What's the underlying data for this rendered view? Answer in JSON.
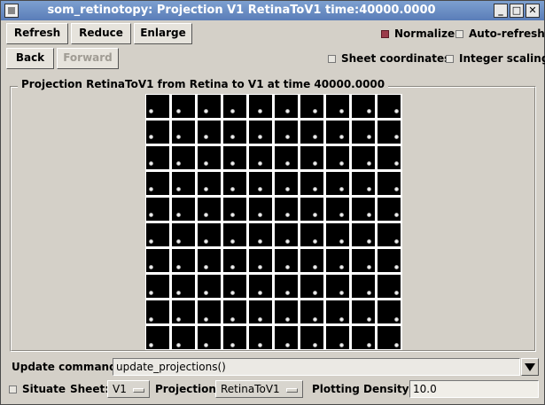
{
  "window": {
    "title": "som_retinotopy: Projection V1 RetinaToV1 time:40000.0000",
    "minimize_icon": "minimize-icon",
    "maximize_icon": "maximize-icon",
    "close_icon": "close-icon"
  },
  "toolbar": {
    "refresh_label": "Refresh",
    "reduce_label": "Reduce",
    "enlarge_label": "Enlarge",
    "back_label": "Back",
    "forward_label": "Forward"
  },
  "options": {
    "normalize_label": "Normalize",
    "normalize_checked": true,
    "auto_refresh_label": "Auto-refresh",
    "auto_refresh_checked": false,
    "sheet_coordinates_label": "Sheet coordinates",
    "sheet_coordinates_checked": false,
    "integer_scaling_label": "Integer scaling",
    "integer_scaling_checked": false
  },
  "projection": {
    "frame_label": "Projection RetinaToV1 from Retina to V1 at time 40000.0000",
    "grid_rows": 10,
    "grid_cols": 10
  },
  "bottom": {
    "update_command_label": "Update command:",
    "update_command_value": "update_projections()",
    "situate_label": "Situate",
    "situate_checked": false,
    "sheet_label": "Sheet:",
    "sheet_value": "V1",
    "projection_label": "Projection:",
    "projection_value": "RetinaToV1",
    "density_label": "Plotting Density:",
    "density_value": "10.0"
  },
  "colors": {
    "checked_box": "#9b3b4a",
    "titlebar": "#6a8cc4",
    "background": "#d4d0c8"
  }
}
